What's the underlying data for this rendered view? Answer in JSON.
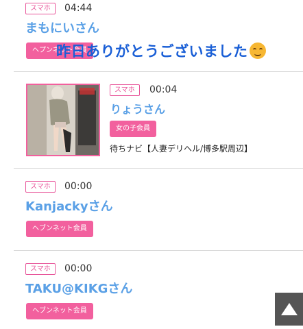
{
  "entries": [
    {
      "device": "スマホ",
      "time": "04:44",
      "name": "まもにいさん",
      "member_badge": "ヘプンネット会員",
      "message": "昨日ありがとうございました"
    },
    {
      "device": "スマホ",
      "time": "00:04",
      "name": "りょうさん",
      "member_badge": "女の子会員",
      "shop": "待ちナビ【人妻デリヘル/博多駅周辺】"
    },
    {
      "device": "スマホ",
      "time": "00:00",
      "name": "Kanjackyさん",
      "member_badge": "ヘブンネット会員"
    },
    {
      "device": "スマホ",
      "time": "00:00",
      "name": "TAKU@KIKGさん",
      "member_badge": "ヘブンネット会員"
    }
  ],
  "icons": {
    "message_emoji": "smiling-face-icon",
    "scroll_top": "up-triangle-icon"
  },
  "colors": {
    "accent_pink": "#f2609e",
    "name_blue": "#5aa0e6",
    "message_blue": "#1a5fd6",
    "scroll_button": "#555555"
  }
}
